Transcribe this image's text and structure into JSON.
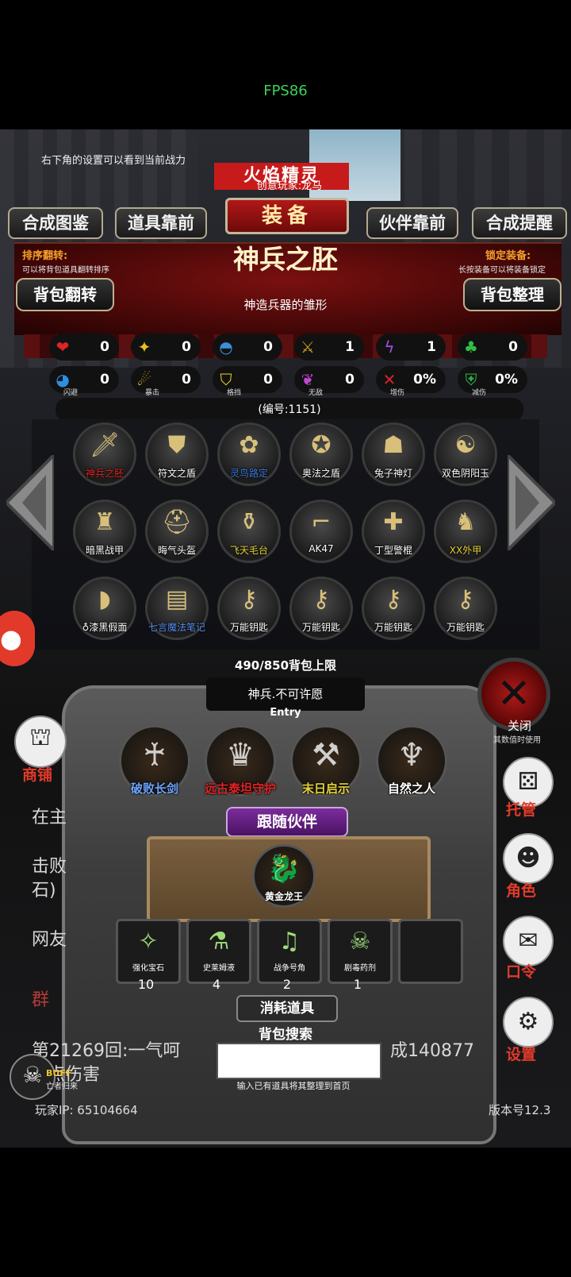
{
  "status": {
    "fps": "FPS86"
  },
  "hint_text": "右下角的设置可以看到当前战力",
  "header": {
    "banner_text": "火焰精灵",
    "player_name": "创意玩家:龙马",
    "title": "装备"
  },
  "top_buttons": [
    "合成图鉴",
    "道具靠前",
    "伙伴靠前",
    "合成提醒"
  ],
  "left_info": {
    "label": "排序翻转:",
    "desc": "可以将背包道具翻转排序",
    "button": "背包翻转"
  },
  "right_info": {
    "label": "锁定装备:",
    "desc": "长按装备可以将装备锁定",
    "button": "背包整理"
  },
  "selected_item": {
    "name": "神兵之胚",
    "desc": "神造兵器的雏形",
    "id_text": "(编号:1151)"
  },
  "stats_row1": [
    {
      "icon": "heart-icon",
      "glyph": "❤",
      "color": "#e02424",
      "value": "0"
    },
    {
      "icon": "armor-icon",
      "glyph": "✦",
      "color": "#e6c21e",
      "value": "0"
    },
    {
      "icon": "helmet-icon",
      "glyph": "◓",
      "color": "#3a8fd6",
      "value": "0"
    },
    {
      "icon": "claw-icon",
      "glyph": "⚔",
      "color": "#c9a11e",
      "value": "1"
    },
    {
      "icon": "lightning-icon",
      "glyph": "ϟ",
      "color": "#a64ce0",
      "value": "1"
    },
    {
      "icon": "clover-icon",
      "glyph": "♣",
      "color": "#2fbf43",
      "value": "0"
    }
  ],
  "stats_row2": [
    {
      "icon": "dodge-icon",
      "glyph": "◕",
      "color": "#2c8fe0",
      "value": "0",
      "label": "闪避"
    },
    {
      "icon": "crit-icon",
      "glyph": "☄",
      "color": "#e7c428",
      "value": "0",
      "label": "暴击"
    },
    {
      "icon": "block-icon",
      "glyph": "⛉",
      "color": "#e8d228",
      "value": "0",
      "label": "格挡"
    },
    {
      "icon": "invincible-icon",
      "glyph": "❦",
      "color": "#c047d0",
      "value": "0",
      "label": "无敌"
    },
    {
      "icon": "damage-up-icon",
      "glyph": "✕",
      "color": "#d8232a",
      "value": "0%",
      "label": "增伤"
    },
    {
      "icon": "damage-down-icon",
      "glyph": "⛨",
      "color": "#29b84c",
      "value": "0%",
      "label": "减伤"
    }
  ],
  "inventory": [
    {
      "name": "神兵之胚",
      "glyph": "🗡",
      "color": "#e02424"
    },
    {
      "name": "符文之盾",
      "glyph": "⛊",
      "color": "#ffffff"
    },
    {
      "name": "灵鸟路定",
      "glyph": "✿",
      "color": "#3b7be0"
    },
    {
      "name": "奥法之盾",
      "glyph": "✪",
      "color": "#ffffff"
    },
    {
      "name": "兔子神灯",
      "glyph": "☗",
      "color": "#ffffff"
    },
    {
      "name": "双色阴阳玉",
      "glyph": "☯",
      "color": "#ffffff"
    },
    {
      "name": "暗黑战甲",
      "glyph": "♜",
      "color": "#ffffff"
    },
    {
      "name": "晦气头盔",
      "glyph": "⛑",
      "color": "#ffffff"
    },
    {
      "name": "飞天毛台",
      "glyph": "⚱",
      "color": "#e6d23a"
    },
    {
      "name": "AK47",
      "glyph": "⌐",
      "color": "#ffffff"
    },
    {
      "name": "丁型警棍",
      "glyph": "✚",
      "color": "#ffffff"
    },
    {
      "name": "XX外甲",
      "glyph": "♞",
      "color": "#e6d23a"
    },
    {
      "name": "♁漆黑假面",
      "glyph": "◗",
      "color": "#ffffff"
    },
    {
      "name": "七言魔法笔记",
      "glyph": "▤",
      "color": "#5a8ef0"
    },
    {
      "name": "万能钥匙",
      "glyph": "⚷",
      "color": "#ffffff"
    },
    {
      "name": "万能钥匙",
      "glyph": "⚷",
      "color": "#ffffff"
    },
    {
      "name": "万能钥匙",
      "glyph": "⚷",
      "color": "#ffffff"
    },
    {
      "name": "万能钥匙",
      "glyph": "⚷",
      "color": "#ffffff"
    }
  ],
  "capacity": "490/850背包上限",
  "entry_gate": {
    "title": "神兵.不可许愿",
    "subtitle": "Entry"
  },
  "partners": [
    {
      "name": "破败长剑",
      "glyph": "♰",
      "color": "#6fa4ff"
    },
    {
      "name": "远古泰坦守护",
      "glyph": "♛",
      "color": "#e02424"
    },
    {
      "name": "末日启示",
      "glyph": "⚒",
      "color": "#e6d23a"
    },
    {
      "name": "自然之人",
      "glyph": "♆",
      "color": "#ffffff"
    }
  ],
  "follow": {
    "label": "跟随伙伴",
    "partner": "黄金龙王",
    "glyph": "🐉"
  },
  "consumables": [
    {
      "name": "强化宝石",
      "glyph": "✧",
      "count": "10"
    },
    {
      "name": "史莱姆液",
      "glyph": "⚗",
      "count": "4"
    },
    {
      "name": "战争号角",
      "glyph": "♫",
      "count": "2"
    },
    {
      "name": "剧毒药剂",
      "glyph": "☠",
      "count": "1"
    },
    {
      "name": "",
      "glyph": "",
      "count": ""
    }
  ],
  "consume_label": "消耗道具",
  "search": {
    "title": "背包搜索",
    "hint": "输入已有道具将其整理到首页",
    "value": ""
  },
  "log_lines": [
    "在主",
    "击败",
    "石)",
    "网友",
    "群",
    "第21269回:一气呵",
    "成140877",
    "点伤害"
  ],
  "left_side": {
    "shop": "商铺",
    "buff": "BUFF",
    "buff_sub": "亡者归来"
  },
  "right_side": {
    "close_partial": "关闭",
    "close_sub": "其数值时使用",
    "items": [
      "托管",
      "角色",
      "口令",
      "设置"
    ]
  },
  "footer": {
    "ip": "玩家IP: 65104664",
    "version": "版本号12.3"
  }
}
